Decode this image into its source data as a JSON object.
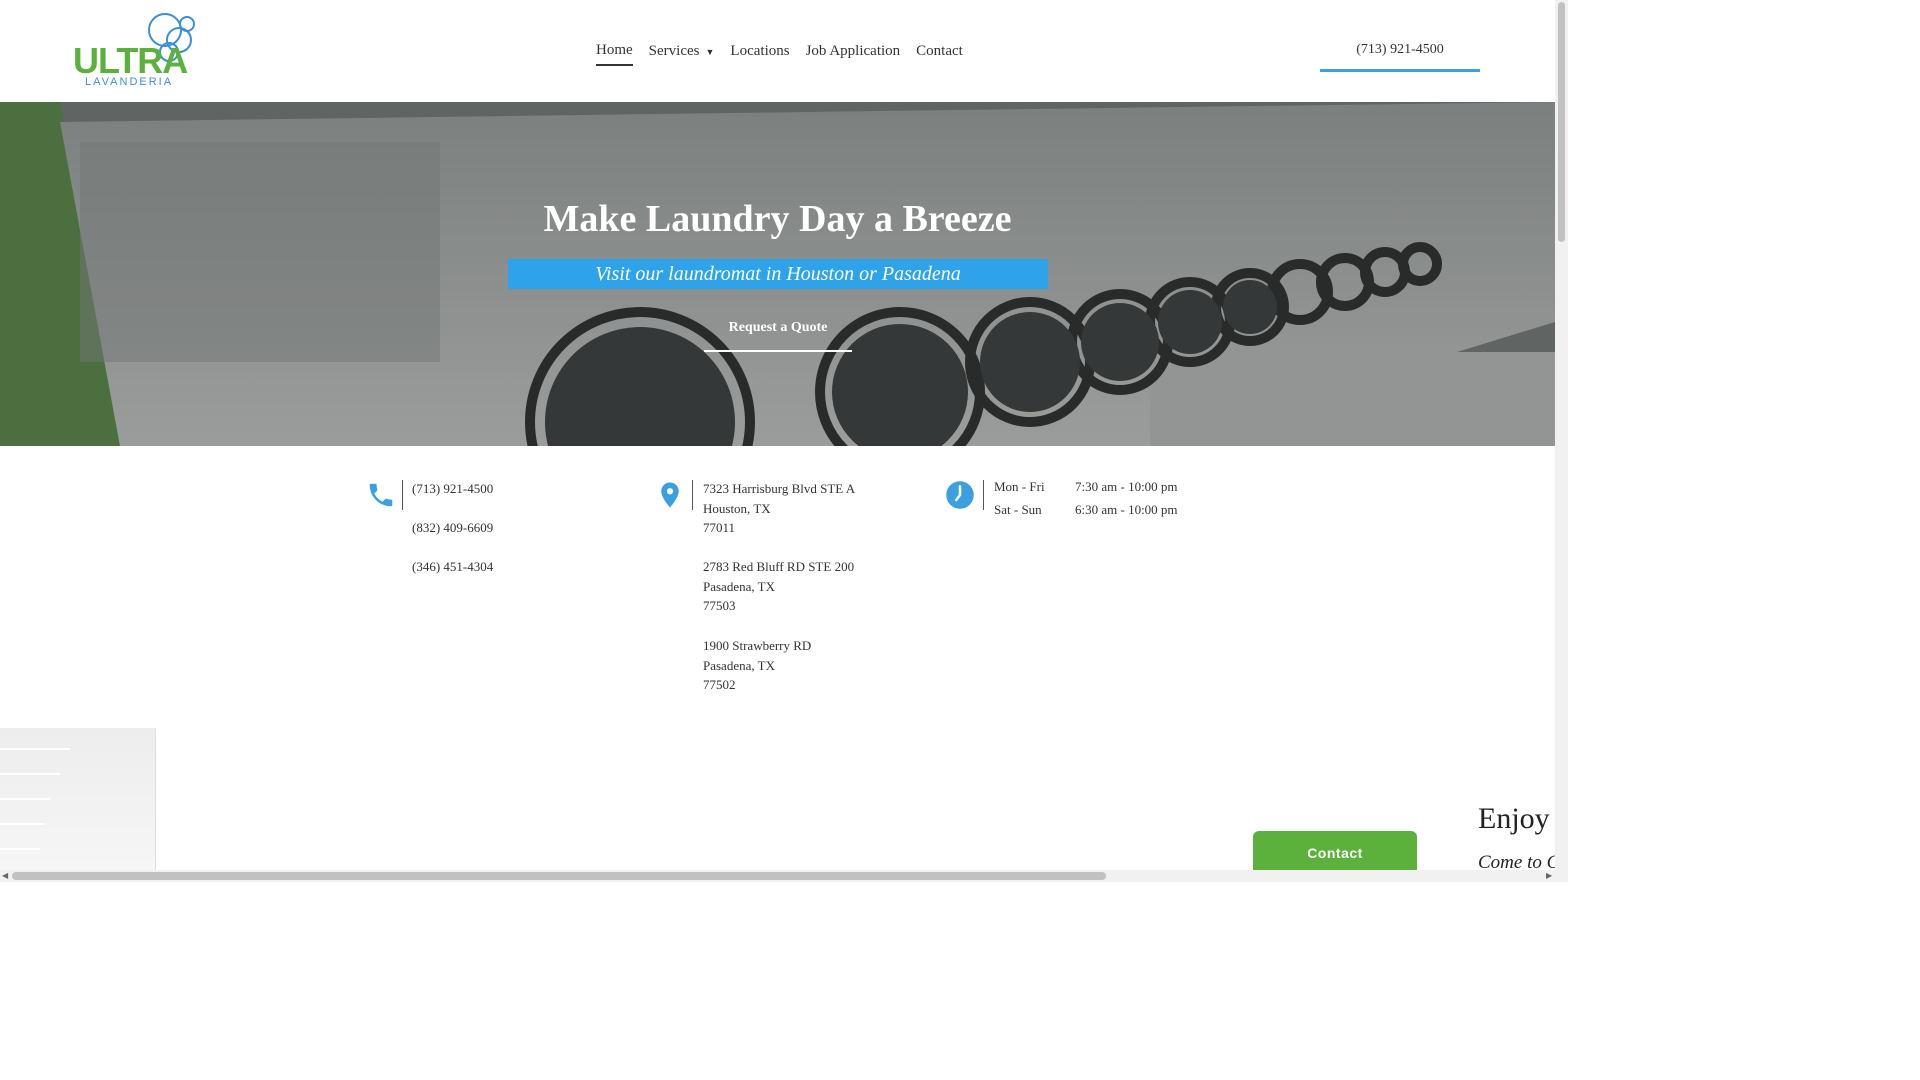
{
  "logo": {
    "title": "ULTRA",
    "subtitle": "LAVANDERIA"
  },
  "nav": {
    "items": [
      {
        "label": "Home",
        "active": true
      },
      {
        "label": "Services",
        "has_dropdown": true
      },
      {
        "label": "Locations"
      },
      {
        "label": "Job Application"
      },
      {
        "label": "Contact"
      }
    ]
  },
  "header_phone": "(713) 921-4500",
  "hero": {
    "title": "Make Laundry Day a Breeze",
    "subtitle": "Visit our laundromat in Houston or Pasadena",
    "cta": "Request a Quote"
  },
  "contact_info": {
    "phones": [
      "(713) 921-4500",
      "(832) 409-6609",
      "(346) 451-4304"
    ],
    "addresses": [
      [
        "7323 Harrisburg Blvd STE A",
        "Houston, TX",
        "77011"
      ],
      [
        "2783 Red Bluff RD STE 200",
        "Pasadena, TX",
        "77503"
      ],
      [
        "1900 Strawberry RD",
        "Pasadena, TX",
        "77502"
      ]
    ],
    "hours": [
      {
        "days": "Mon - Fri",
        "time": "7:30 am - 10:00 pm"
      },
      {
        "days": "Sat - Sun",
        "time": "6:30 am - 10:00 pm"
      }
    ]
  },
  "lower": {
    "heading": "Enjoy",
    "subheading": "Come to C"
  },
  "contact_widget": "Contact",
  "colors": {
    "brand_green": "#5bb13b",
    "brand_blue": "#2ea3ea",
    "icon_blue": "#3b9fe0"
  },
  "icons": [
    "phone-icon",
    "location-pin-icon",
    "clock-icon",
    "chevron-down-icon"
  ]
}
